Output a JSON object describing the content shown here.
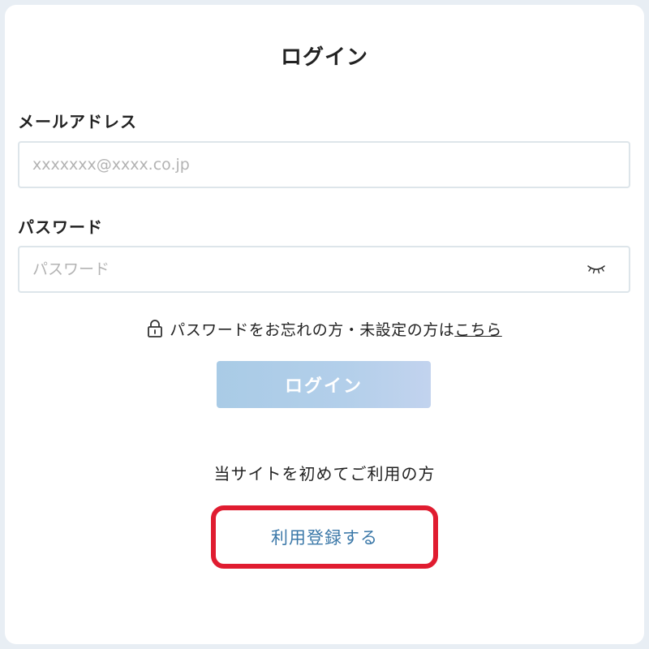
{
  "page": {
    "title": "ログイン"
  },
  "email": {
    "label": "メールアドレス",
    "value": "",
    "placeholder": "xxxxxxx@xxxx.co.jp"
  },
  "password": {
    "label": "パスワード",
    "value": "",
    "placeholder": "パスワード",
    "toggle_icon": "eye-closed-icon"
  },
  "forgot": {
    "icon": "lock-icon",
    "text": "パスワードをお忘れの方・未設定の方は",
    "link_text": "こちら"
  },
  "login_button": {
    "label": "ログイン"
  },
  "register": {
    "prompt": "当サイトを初めてご利用の方",
    "button_label": "利用登録する",
    "highlight_color": "#e01c30"
  },
  "colors": {
    "accent": "#3b78a8",
    "login_button_bg": "#aecbe7",
    "highlight": "#e01c30"
  }
}
